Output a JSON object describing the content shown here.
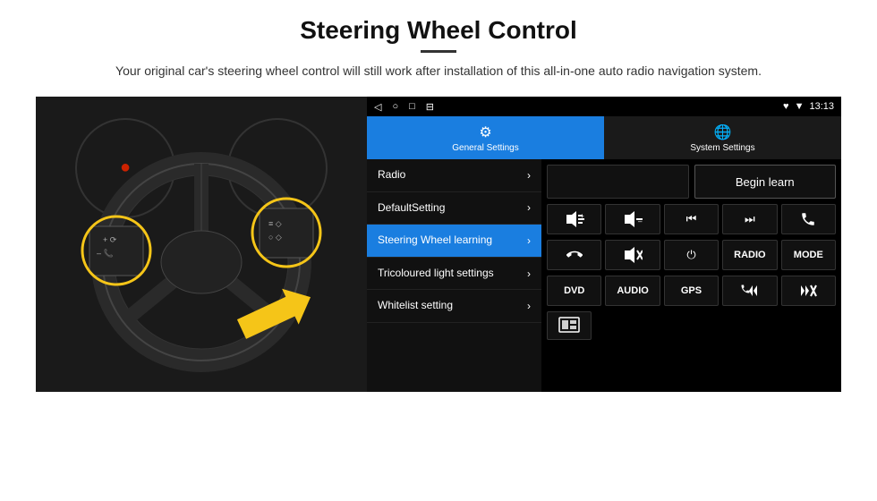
{
  "header": {
    "title": "Steering Wheel Control",
    "subtitle": "Your original car's steering wheel control will still work after installation of this all-in-one auto radio navigation system."
  },
  "status_bar": {
    "nav_icons": [
      "◁",
      "○",
      "□",
      "⊟"
    ],
    "right_icons": [
      "♥",
      "▼",
      "13:13"
    ]
  },
  "tabs": [
    {
      "id": "general",
      "label": "General Settings",
      "active": true
    },
    {
      "id": "system",
      "label": "System Settings",
      "active": false
    }
  ],
  "menu_items": [
    {
      "id": "radio",
      "label": "Radio",
      "active": false
    },
    {
      "id": "default",
      "label": "DefaultSetting",
      "active": false
    },
    {
      "id": "steering",
      "label": "Steering Wheel learning",
      "active": true
    },
    {
      "id": "tricoloured",
      "label": "Tricoloured light settings",
      "active": false
    },
    {
      "id": "whitelist",
      "label": "Whitelist setting",
      "active": false
    }
  ],
  "right_panel": {
    "begin_learn_label": "Begin learn",
    "control_buttons_row1": [
      {
        "id": "vol-up",
        "symbol": "🔊+",
        "text": "◀+",
        "type": "icon"
      },
      {
        "id": "vol-down",
        "symbol": "◀-",
        "text": "◀–",
        "type": "icon"
      },
      {
        "id": "prev-track",
        "symbol": "⏮",
        "text": "⏮",
        "type": "icon"
      },
      {
        "id": "next-track",
        "symbol": "⏭",
        "text": "⏭",
        "type": "icon"
      },
      {
        "id": "phone",
        "symbol": "📞",
        "text": "✆",
        "type": "icon"
      }
    ],
    "control_buttons_row2": [
      {
        "id": "hang-up",
        "symbol": "↩",
        "text": "↩",
        "type": "icon"
      },
      {
        "id": "mute",
        "symbol": "🔇",
        "text": "◀✕",
        "type": "icon"
      },
      {
        "id": "power",
        "symbol": "⏻",
        "text": "⏻",
        "type": "icon"
      },
      {
        "id": "radio-btn",
        "text": "RADIO",
        "type": "text"
      },
      {
        "id": "mode",
        "text": "MODE",
        "type": "text"
      }
    ],
    "control_buttons_row3": [
      {
        "id": "dvd",
        "text": "DVD",
        "type": "text"
      },
      {
        "id": "audio",
        "text": "AUDIO",
        "type": "text"
      },
      {
        "id": "gps",
        "text": "GPS",
        "type": "text"
      },
      {
        "id": "phone2",
        "symbol": "✆⏮",
        "text": "✆⏮",
        "type": "icon"
      },
      {
        "id": "next2",
        "symbol": "⏭✕",
        "text": "⏭",
        "type": "icon"
      }
    ],
    "icon_row": [
      {
        "id": "screen-icon",
        "symbol": "▦",
        "type": "icon"
      }
    ]
  }
}
